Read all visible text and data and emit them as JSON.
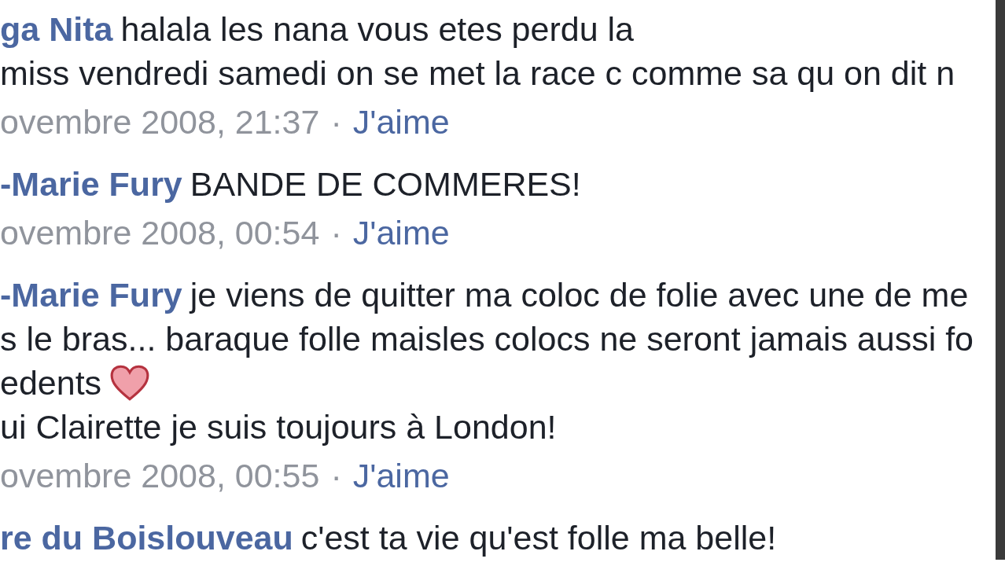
{
  "comments": [
    {
      "author": "ga Nita",
      "lines": [
        {
          "text": "halala les nana vous etes perdu la"
        },
        {
          "text": "miss vendredi samedi on se met la race c comme sa qu on dit n"
        }
      ],
      "date": "ovembre 2008, 21:37",
      "separator": "·",
      "like": "J'aime"
    },
    {
      "author": "-Marie Fury",
      "lines": [
        {
          "text": "BANDE DE COMMERES!"
        }
      ],
      "date": "ovembre 2008, 00:54",
      "separator": "·",
      "like": "J'aime"
    },
    {
      "author": "-Marie Fury",
      "lines": [
        {
          "text": "je viens de quitter ma coloc de folie avec une de me"
        },
        {
          "text": "s le bras... baraque folle maisles colocs ne seront jamais aussi fo"
        },
        {
          "text": "edents",
          "kind": "emoji"
        },
        {
          "text": "ui Clairette je suis toujours à London!"
        }
      ],
      "date": "ovembre 2008, 00:55",
      "separator": "·",
      "like": "J'aime"
    },
    {
      "author": "re du Boislouveau",
      "lines": [
        {
          "text": "c'est ta vie qu'est folle ma belle!"
        }
      ]
    }
  ]
}
